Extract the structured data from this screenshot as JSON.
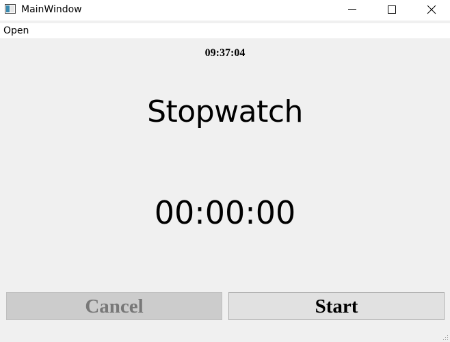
{
  "window": {
    "title": "MainWindow",
    "controls": [
      "minimize-icon",
      "maximize-icon",
      "close-icon"
    ]
  },
  "menu": {
    "items": [
      {
        "label": "Open"
      }
    ]
  },
  "main": {
    "clock": "09:37:04",
    "heading": "Stopwatch",
    "timer": "00:00:00",
    "buttons": {
      "cancel": {
        "label": "Cancel",
        "enabled": false
      },
      "start": {
        "label": "Start",
        "enabled": true
      }
    }
  },
  "colors": {
    "background": "#f0f0f0",
    "titlebar": "#ffffff",
    "disabled_button": "#cccccc",
    "disabled_text": "#787878",
    "button": "#e1e1e1"
  }
}
